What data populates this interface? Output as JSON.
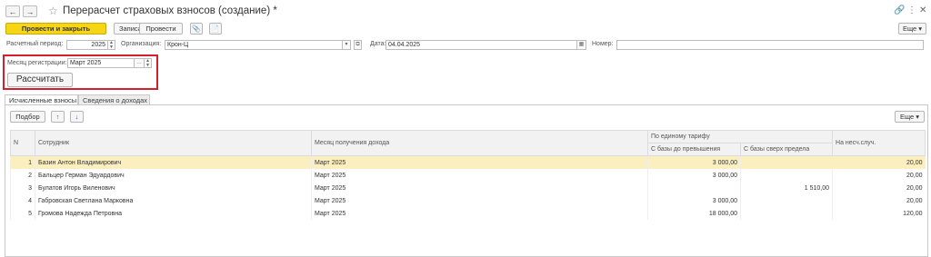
{
  "window": {
    "title": "Перерасчет страховых взносов (создание) *",
    "nav_back": "←",
    "nav_forward": "→",
    "star": "☆",
    "link_icon": "🔗",
    "menu_icon": "⋮",
    "close_icon": "✕"
  },
  "toolbar": {
    "post_close": "Провести и закрыть",
    "save": "Записать",
    "post": "Провести",
    "more": "Еще ▾"
  },
  "header": {
    "period_label": "Расчетный период:",
    "period_value": "2025",
    "org_label": "Организация:",
    "org_value": "Крон-Ц",
    "date_label": "Дата:",
    "date_value": "04.04.2025",
    "number_label": "Номер:",
    "number_value": ""
  },
  "registration": {
    "month_label": "Месяц регистрации:",
    "month_value": "Март 2025",
    "calculate": "Рассчитать"
  },
  "tabs": [
    {
      "label": "Исчисленные взносы"
    },
    {
      "label": "Сведения о доходах"
    }
  ],
  "table_toolbar": {
    "pick": "Подбор",
    "up": "↑",
    "down": "↓",
    "more": "Еще ▾"
  },
  "columns": {
    "n": "N",
    "employee": "Сотрудник",
    "month": "Месяц получения дохода",
    "unified_tariff": "По единому тарифу",
    "base_below": "С базы до превышения",
    "base_above": "С базы сверх предела",
    "accident": "На несч.случ."
  },
  "rows": [
    {
      "n": "1",
      "employee": "Базин Антон Владимирович",
      "month": "Март 2025",
      "base_below": "3 000,00",
      "base_above": "",
      "accident": "20,00"
    },
    {
      "n": "2",
      "employee": "Бальцер Герман Эдуардович",
      "month": "Март 2025",
      "base_below": "3 000,00",
      "base_above": "",
      "accident": "20,00"
    },
    {
      "n": "3",
      "employee": "Булатов Игорь Виленович",
      "month": "Март 2025",
      "base_below": "",
      "base_above": "1 510,00",
      "accident": "20,00"
    },
    {
      "n": "4",
      "employee": "Габровская Светлана Марковна",
      "month": "Март 2025",
      "base_below": "3 000,00",
      "base_above": "",
      "accident": "20,00"
    },
    {
      "n": "5",
      "employee": "Громова Надежда Петровна",
      "month": "Март 2025",
      "base_below": "18 000,00",
      "base_above": "",
      "accident": "120,00"
    }
  ]
}
